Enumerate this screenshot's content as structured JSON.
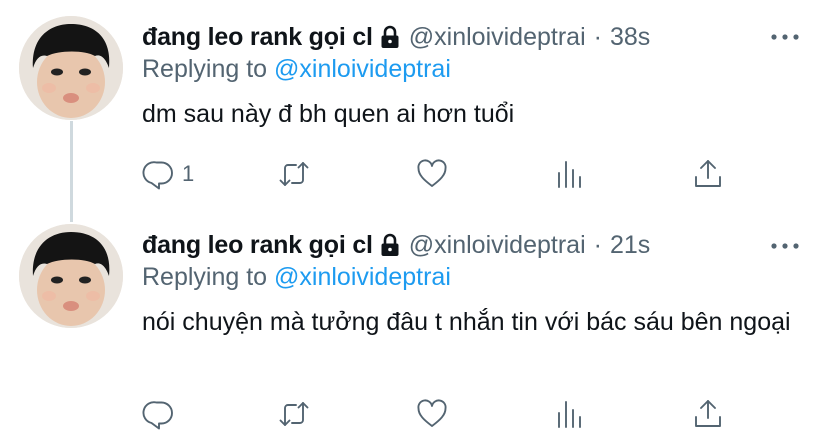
{
  "tweets": [
    {
      "display_name": "đang leo rank gọi cl",
      "handle": "@xinloivideptrai",
      "separator": "·",
      "time": "38s",
      "replying_prefix": "Replying to",
      "replying_to": "@xinloivideptrai",
      "text": "dm sau này đ bh quen ai hơn tuổi",
      "reply_count": "1"
    },
    {
      "display_name": "đang leo rank gọi cl",
      "handle": "@xinloivideptrai",
      "separator": "·",
      "time": "21s",
      "replying_prefix": "Replying to",
      "replying_to": "@xinloivideptrai",
      "text": "nói chuyện mà tưởng đâu t nhắn tin với bác sáu bên ngoại",
      "reply_count": ""
    }
  ],
  "icons": [
    "lock-icon",
    "more-icon",
    "reply-icon",
    "retweet-icon",
    "like-icon",
    "stats-icon",
    "share-icon"
  ],
  "colors": {
    "link": "#1d9bf0",
    "secondary": "#536471",
    "primary_text": "#0f1419",
    "thread_line": "#cfd9de"
  }
}
